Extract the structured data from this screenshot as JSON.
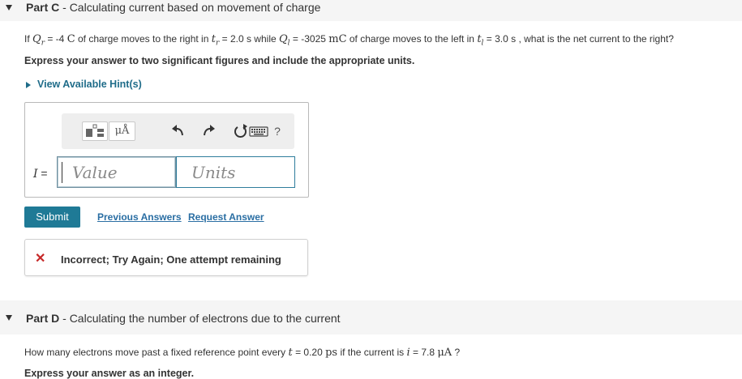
{
  "part_c": {
    "label": "Part C",
    "separator": " - ",
    "title": "Calculating current based on movement of charge",
    "question": {
      "s1": "If ",
      "qr": "Q",
      "qr_sub": "r",
      "s2": " = -4 ",
      "unit_c": "C",
      "s3": " of charge moves to the right in ",
      "tr": "t",
      "tr_sub": "r",
      "s4": " = 2.0 s while ",
      "ql": "Q",
      "ql_sub": "l",
      "s5": " = -3025 ",
      "unit_mc": "mC",
      "s6": " of charge moves to the left in ",
      "tl": "t",
      "tl_sub": "l",
      "s7": " = 3.0 s , what is the net current to the right?"
    },
    "instruction": "Express your answer to two significant figures and include the appropriate units.",
    "hint_label": "View Available Hint(s)",
    "toolbar": {
      "mu_label": "μÅ",
      "help_label": "?",
      "icons": [
        "templates-icon",
        "units-icon",
        "undo-icon",
        "redo-icon",
        "reset-icon",
        "keyboard-icon",
        "help-icon"
      ]
    },
    "variable": "I",
    "equals": " =",
    "value_placeholder": "Value",
    "units_placeholder": "Units",
    "submit_label": "Submit",
    "previous_answers_label": "Previous Answers",
    "request_answer_label": "Request Answer",
    "feedback": {
      "icon": "x-icon",
      "message": "Incorrect; Try Again; One attempt remaining",
      "color": "#c62828"
    }
  },
  "part_d": {
    "label": "Part D",
    "separator": " - ",
    "title": "Calculating the number of electrons due to the current",
    "question": {
      "s1": "How many electrons move past a fixed reference point every ",
      "t": "t",
      "s2": " = 0.20 ",
      "unit_ps": "ps",
      "s3": " if the current is ",
      "i": "i",
      "s4": " = 7.8 ",
      "unit_ua": "μA",
      "s5": " ?"
    },
    "instruction": "Express your answer as an integer."
  },
  "colors": {
    "accent": "#1f7a96",
    "link": "#2a6ea3",
    "header_bg": "#f5f5f5"
  }
}
